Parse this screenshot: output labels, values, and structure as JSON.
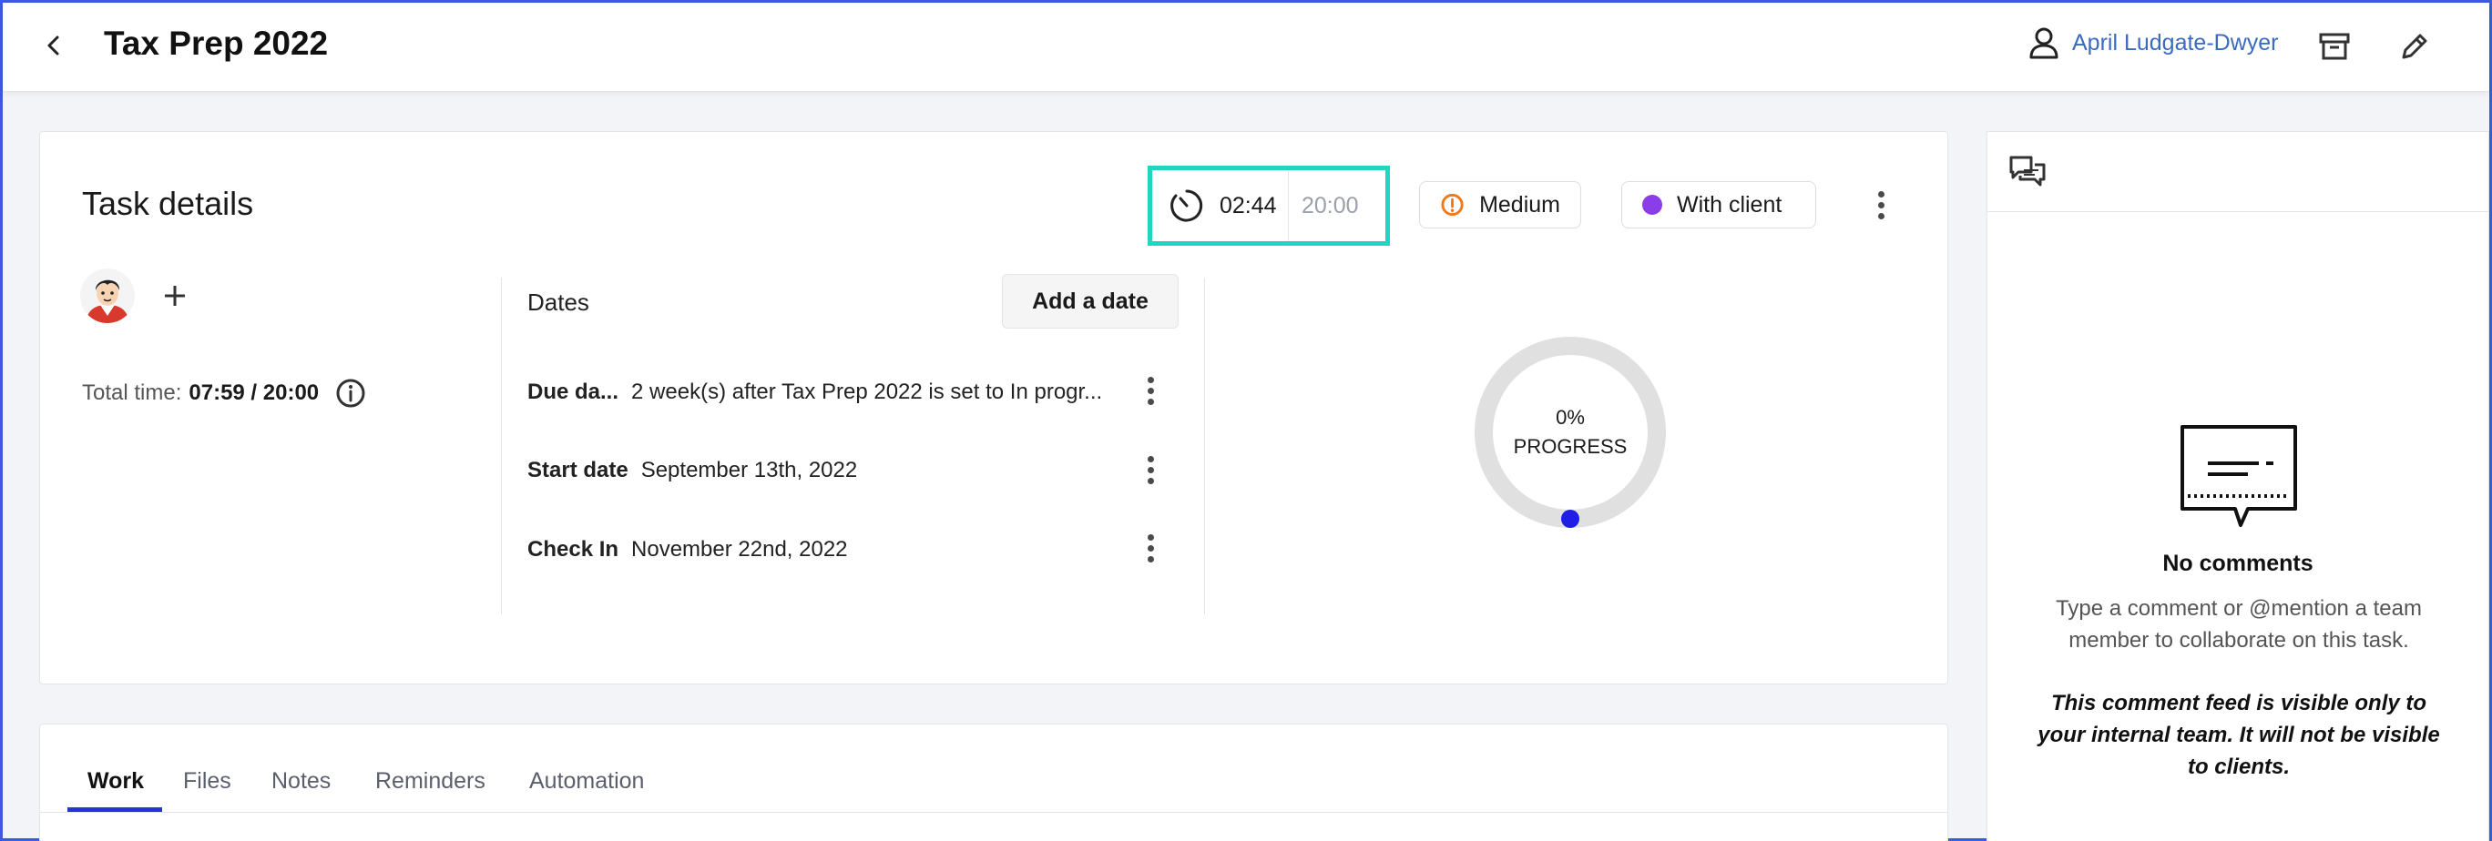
{
  "header": {
    "title": "Tax Prep 2022",
    "assignee_name": "April Ludgate-Dwyer"
  },
  "task_details": {
    "title": "Task details",
    "timer": {
      "elapsed": "02:44",
      "estimate": "20:00"
    },
    "priority": {
      "label": "Medium",
      "color": "#f07a1a"
    },
    "status": {
      "label": "With client",
      "color": "#8b3dea"
    },
    "total_time": {
      "label": "Total time:",
      "value": "07:59 / 20:00"
    },
    "dates": {
      "section_label": "Dates",
      "add_button": "Add a date",
      "rows": [
        {
          "label": "Due da...",
          "value": "2 week(s) after Tax Prep 2022 is set to In progr..."
        },
        {
          "label": "Start date",
          "value": "September 13th, 2022"
        },
        {
          "label": "Check In",
          "value": "November 22nd, 2022"
        }
      ]
    },
    "progress": {
      "percent_label": "0%",
      "caption": "PROGRESS",
      "fraction": 0
    }
  },
  "tabs": [
    {
      "label": "Work",
      "active": true
    },
    {
      "label": "Files",
      "active": false
    },
    {
      "label": "Notes",
      "active": false
    },
    {
      "label": "Reminders",
      "active": false
    },
    {
      "label": "Automation",
      "active": false
    }
  ],
  "comments": {
    "empty_title": "No comments",
    "empty_hint": "Type a comment or @mention a team member to collaborate on this task.",
    "visibility_notice": "This comment feed is visible only to your internal team. It will not be visible to clients."
  },
  "colors": {
    "accent": "#2733d6",
    "timer_highlight": "#1fd6c0",
    "link": "#3a6bbf"
  }
}
